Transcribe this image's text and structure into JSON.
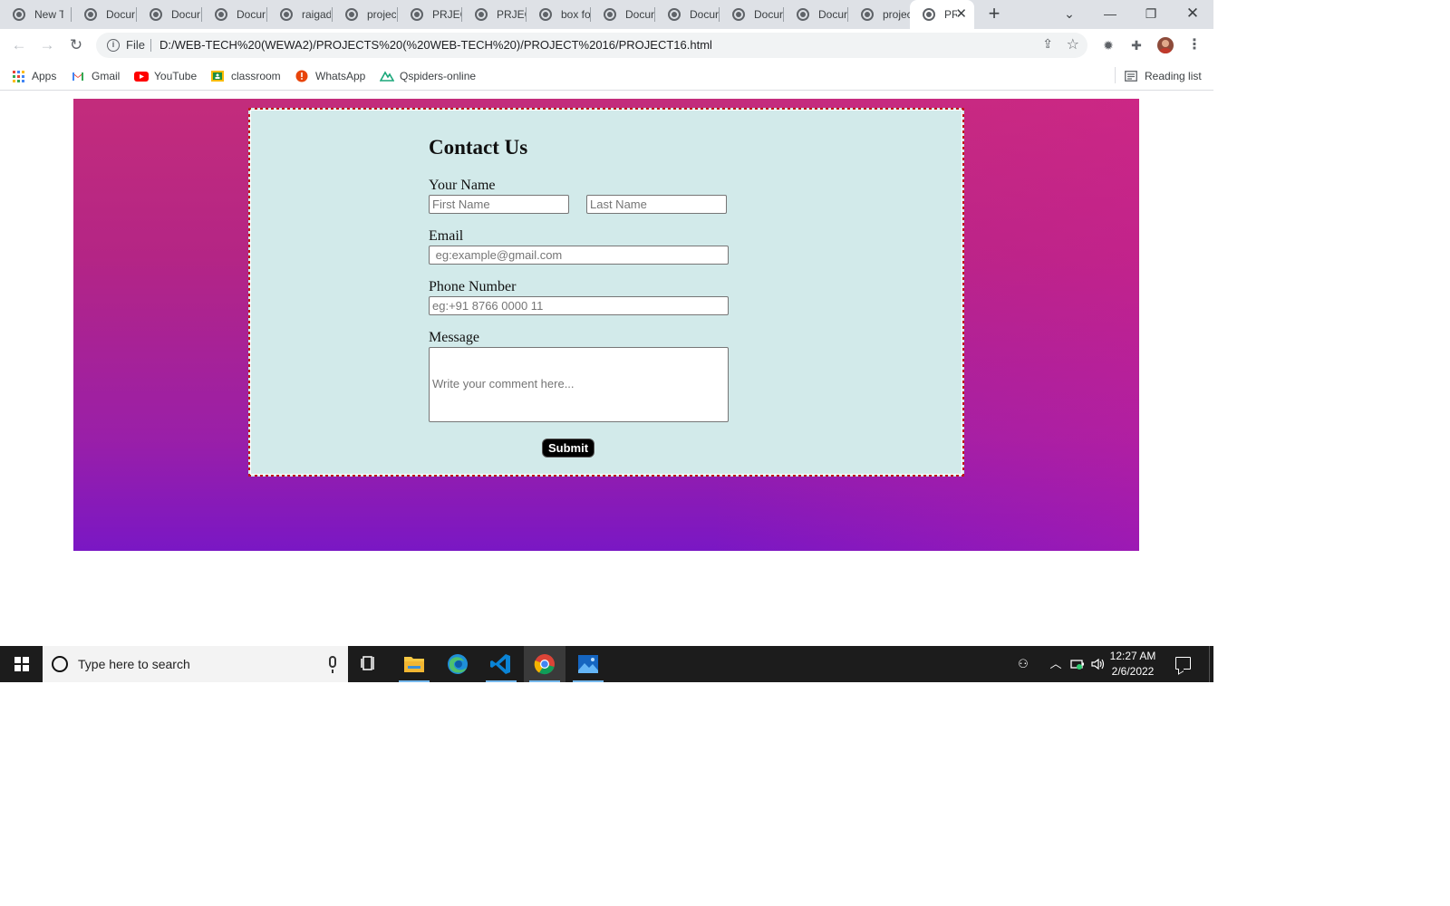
{
  "browser": {
    "tabs": [
      {
        "title": "New T"
      },
      {
        "title": "Docur"
      },
      {
        "title": "Docur"
      },
      {
        "title": "Docur"
      },
      {
        "title": "raigad"
      },
      {
        "title": "projec"
      },
      {
        "title": "PRJEC"
      },
      {
        "title": "PRJEC"
      },
      {
        "title": "box fo"
      },
      {
        "title": "Docur"
      },
      {
        "title": "Docur"
      },
      {
        "title": "Docur"
      },
      {
        "title": "Docur"
      },
      {
        "title": "projec"
      },
      {
        "title": "PR",
        "active": true
      }
    ],
    "new_tab_symbol": "+",
    "address": {
      "scheme": "File",
      "url": "D:/WEB-TECH%20(WEWA2)/PROJECTS%20(%20WEB-TECH%20)/PROJECT%2016/PROJECT16.html"
    },
    "bookmarks": [
      {
        "label": "Apps",
        "icon": "apps-grid-icon"
      },
      {
        "label": "Gmail",
        "icon": "gmail-icon"
      },
      {
        "label": "YouTube",
        "icon": "youtube-icon"
      },
      {
        "label": "classroom",
        "icon": "classroom-icon"
      },
      {
        "label": "WhatsApp",
        "icon": "whatsapp-icon"
      },
      {
        "label": "Qspiders-online",
        "icon": "qspiders-icon"
      }
    ],
    "reading_list": "Reading list"
  },
  "form": {
    "title": "Contact Us",
    "name_label": "Your Name",
    "first_name_placeholder": "First Name",
    "last_name_placeholder": "Last Name",
    "email_label": "Email",
    "email_placeholder": " eg:example@gmail.com",
    "phone_label": "Phone Number",
    "phone_placeholder": "eg:+91 8766 0000 11",
    "message_label": "Message",
    "message_placeholder": "Write your comment here...",
    "submit_label": "Submit"
  },
  "taskbar": {
    "search_placeholder": "Type here to search",
    "apps": [
      "task-view-icon",
      "file-explorer-icon",
      "edge-icon",
      "vscode-icon",
      "chrome-icon",
      "photos-icon"
    ],
    "time": "12:27 AM",
    "date": "2/6/2022"
  },
  "colors": {
    "gradient_top": "#c32c7c",
    "gradient_bottom": "#7a17c4",
    "card_bg": "#d2eaea",
    "card_border": "#c01818",
    "submit_bg": "#000000"
  }
}
